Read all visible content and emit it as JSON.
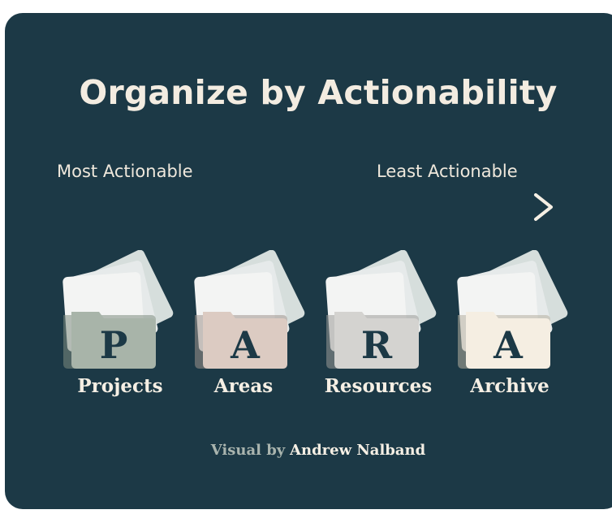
{
  "title": "Organize by Actionability",
  "scale": {
    "left_label": "Most Actionable",
    "right_label": "Least Actionable"
  },
  "categories": [
    {
      "letter": "P",
      "label": "Projects",
      "folder_color": "#a8b4a9"
    },
    {
      "letter": "A",
      "label": "Areas",
      "folder_color": "#dccbc2"
    },
    {
      "letter": "R",
      "label": "Resources",
      "folder_color": "#d4d3d0"
    },
    {
      "letter": "A",
      "label": "Archive",
      "folder_color": "#f5eee2"
    }
  ],
  "credit": {
    "prefix": "Visual by",
    "author": "Andrew Nalband"
  },
  "colors": {
    "background": "#1c3946",
    "text": "#f3ece1",
    "letter": "#1c3946"
  },
  "icons": [
    "folder-icon",
    "arrow-right-icon"
  ]
}
